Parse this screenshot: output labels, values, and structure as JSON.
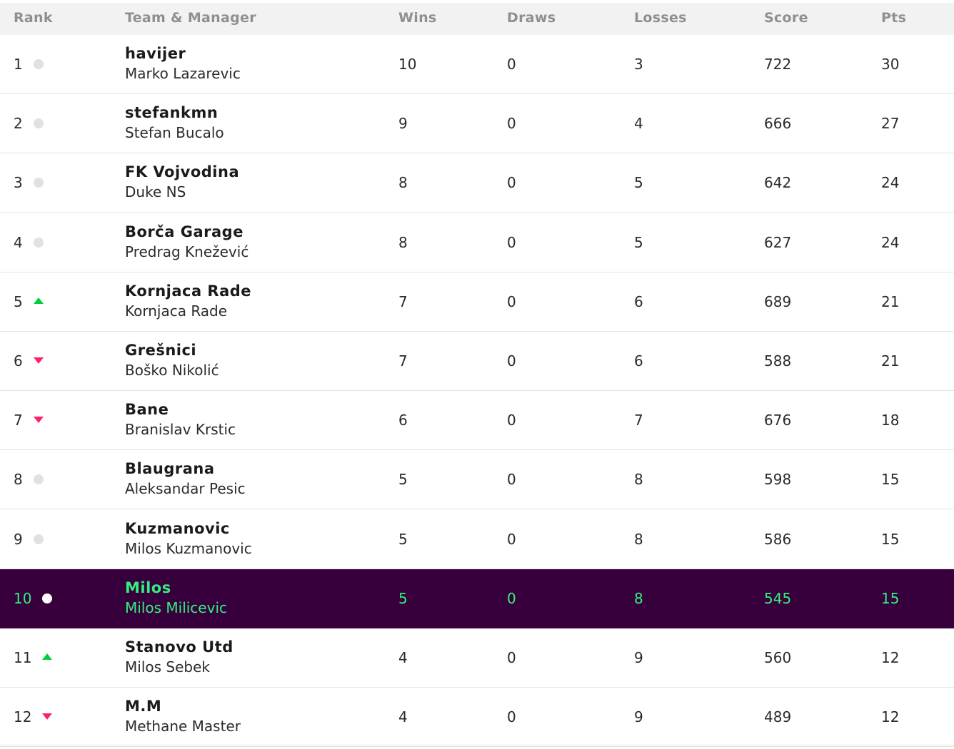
{
  "columns": {
    "rank": "Rank",
    "team_manager": "Team & Manager",
    "wins": "Wins",
    "draws": "Draws",
    "losses": "Losses",
    "score": "Score",
    "pts": "Pts"
  },
  "rows": [
    {
      "rank": "1",
      "movement": "same",
      "team": "havijer",
      "manager": "Marko Lazarevic",
      "wins": "10",
      "draws": "0",
      "losses": "3",
      "score": "722",
      "pts": "30",
      "highlighted": false
    },
    {
      "rank": "2",
      "movement": "same",
      "team": "stefankmn",
      "manager": "Stefan Bucalo",
      "wins": "9",
      "draws": "0",
      "losses": "4",
      "score": "666",
      "pts": "27",
      "highlighted": false
    },
    {
      "rank": "3",
      "movement": "same",
      "team": "FK Vojvodina",
      "manager": "Duke NS",
      "wins": "8",
      "draws": "0",
      "losses": "5",
      "score": "642",
      "pts": "24",
      "highlighted": false
    },
    {
      "rank": "4",
      "movement": "same",
      "team": "Borča Garage",
      "manager": "Predrag Knežević",
      "wins": "8",
      "draws": "0",
      "losses": "5",
      "score": "627",
      "pts": "24",
      "highlighted": false
    },
    {
      "rank": "5",
      "movement": "up",
      "team": "Kornjaca Rade",
      "manager": "Kornjaca Rade",
      "wins": "7",
      "draws": "0",
      "losses": "6",
      "score": "689",
      "pts": "21",
      "highlighted": false
    },
    {
      "rank": "6",
      "movement": "down",
      "team": "Grešnici",
      "manager": "Boško Nikolić",
      "wins": "7",
      "draws": "0",
      "losses": "6",
      "score": "588",
      "pts": "21",
      "highlighted": false
    },
    {
      "rank": "7",
      "movement": "down",
      "team": "Bane",
      "manager": "Branislav Krstic",
      "wins": "6",
      "draws": "0",
      "losses": "7",
      "score": "676",
      "pts": "18",
      "highlighted": false
    },
    {
      "rank": "8",
      "movement": "same",
      "team": "Blaugrana",
      "manager": "Aleksandar Pesic",
      "wins": "5",
      "draws": "0",
      "losses": "8",
      "score": "598",
      "pts": "15",
      "highlighted": false
    },
    {
      "rank": "9",
      "movement": "same",
      "team": "Kuzmanovic",
      "manager": "Milos Kuzmanovic",
      "wins": "5",
      "draws": "0",
      "losses": "8",
      "score": "586",
      "pts": "15",
      "highlighted": false
    },
    {
      "rank": "10",
      "movement": "same",
      "team": "Milos",
      "manager": "Milos Milicevic",
      "wins": "5",
      "draws": "0",
      "losses": "8",
      "score": "545",
      "pts": "15",
      "highlighted": true
    },
    {
      "rank": "11",
      "movement": "up",
      "team": "Stanovo Utd",
      "manager": "Milos Sebek",
      "wins": "4",
      "draws": "0",
      "losses": "9",
      "score": "560",
      "pts": "12",
      "highlighted": false
    },
    {
      "rank": "12",
      "movement": "down",
      "team": "M.M",
      "manager": "Methane Master",
      "wins": "4",
      "draws": "0",
      "losses": "9",
      "score": "489",
      "pts": "12",
      "highlighted": false
    }
  ],
  "colors": {
    "highlight_bg": "#37003c",
    "highlight_text": "#32f07e",
    "up": "#00d13a",
    "down": "#ff1f6b",
    "same": "#e1e1e1"
  }
}
